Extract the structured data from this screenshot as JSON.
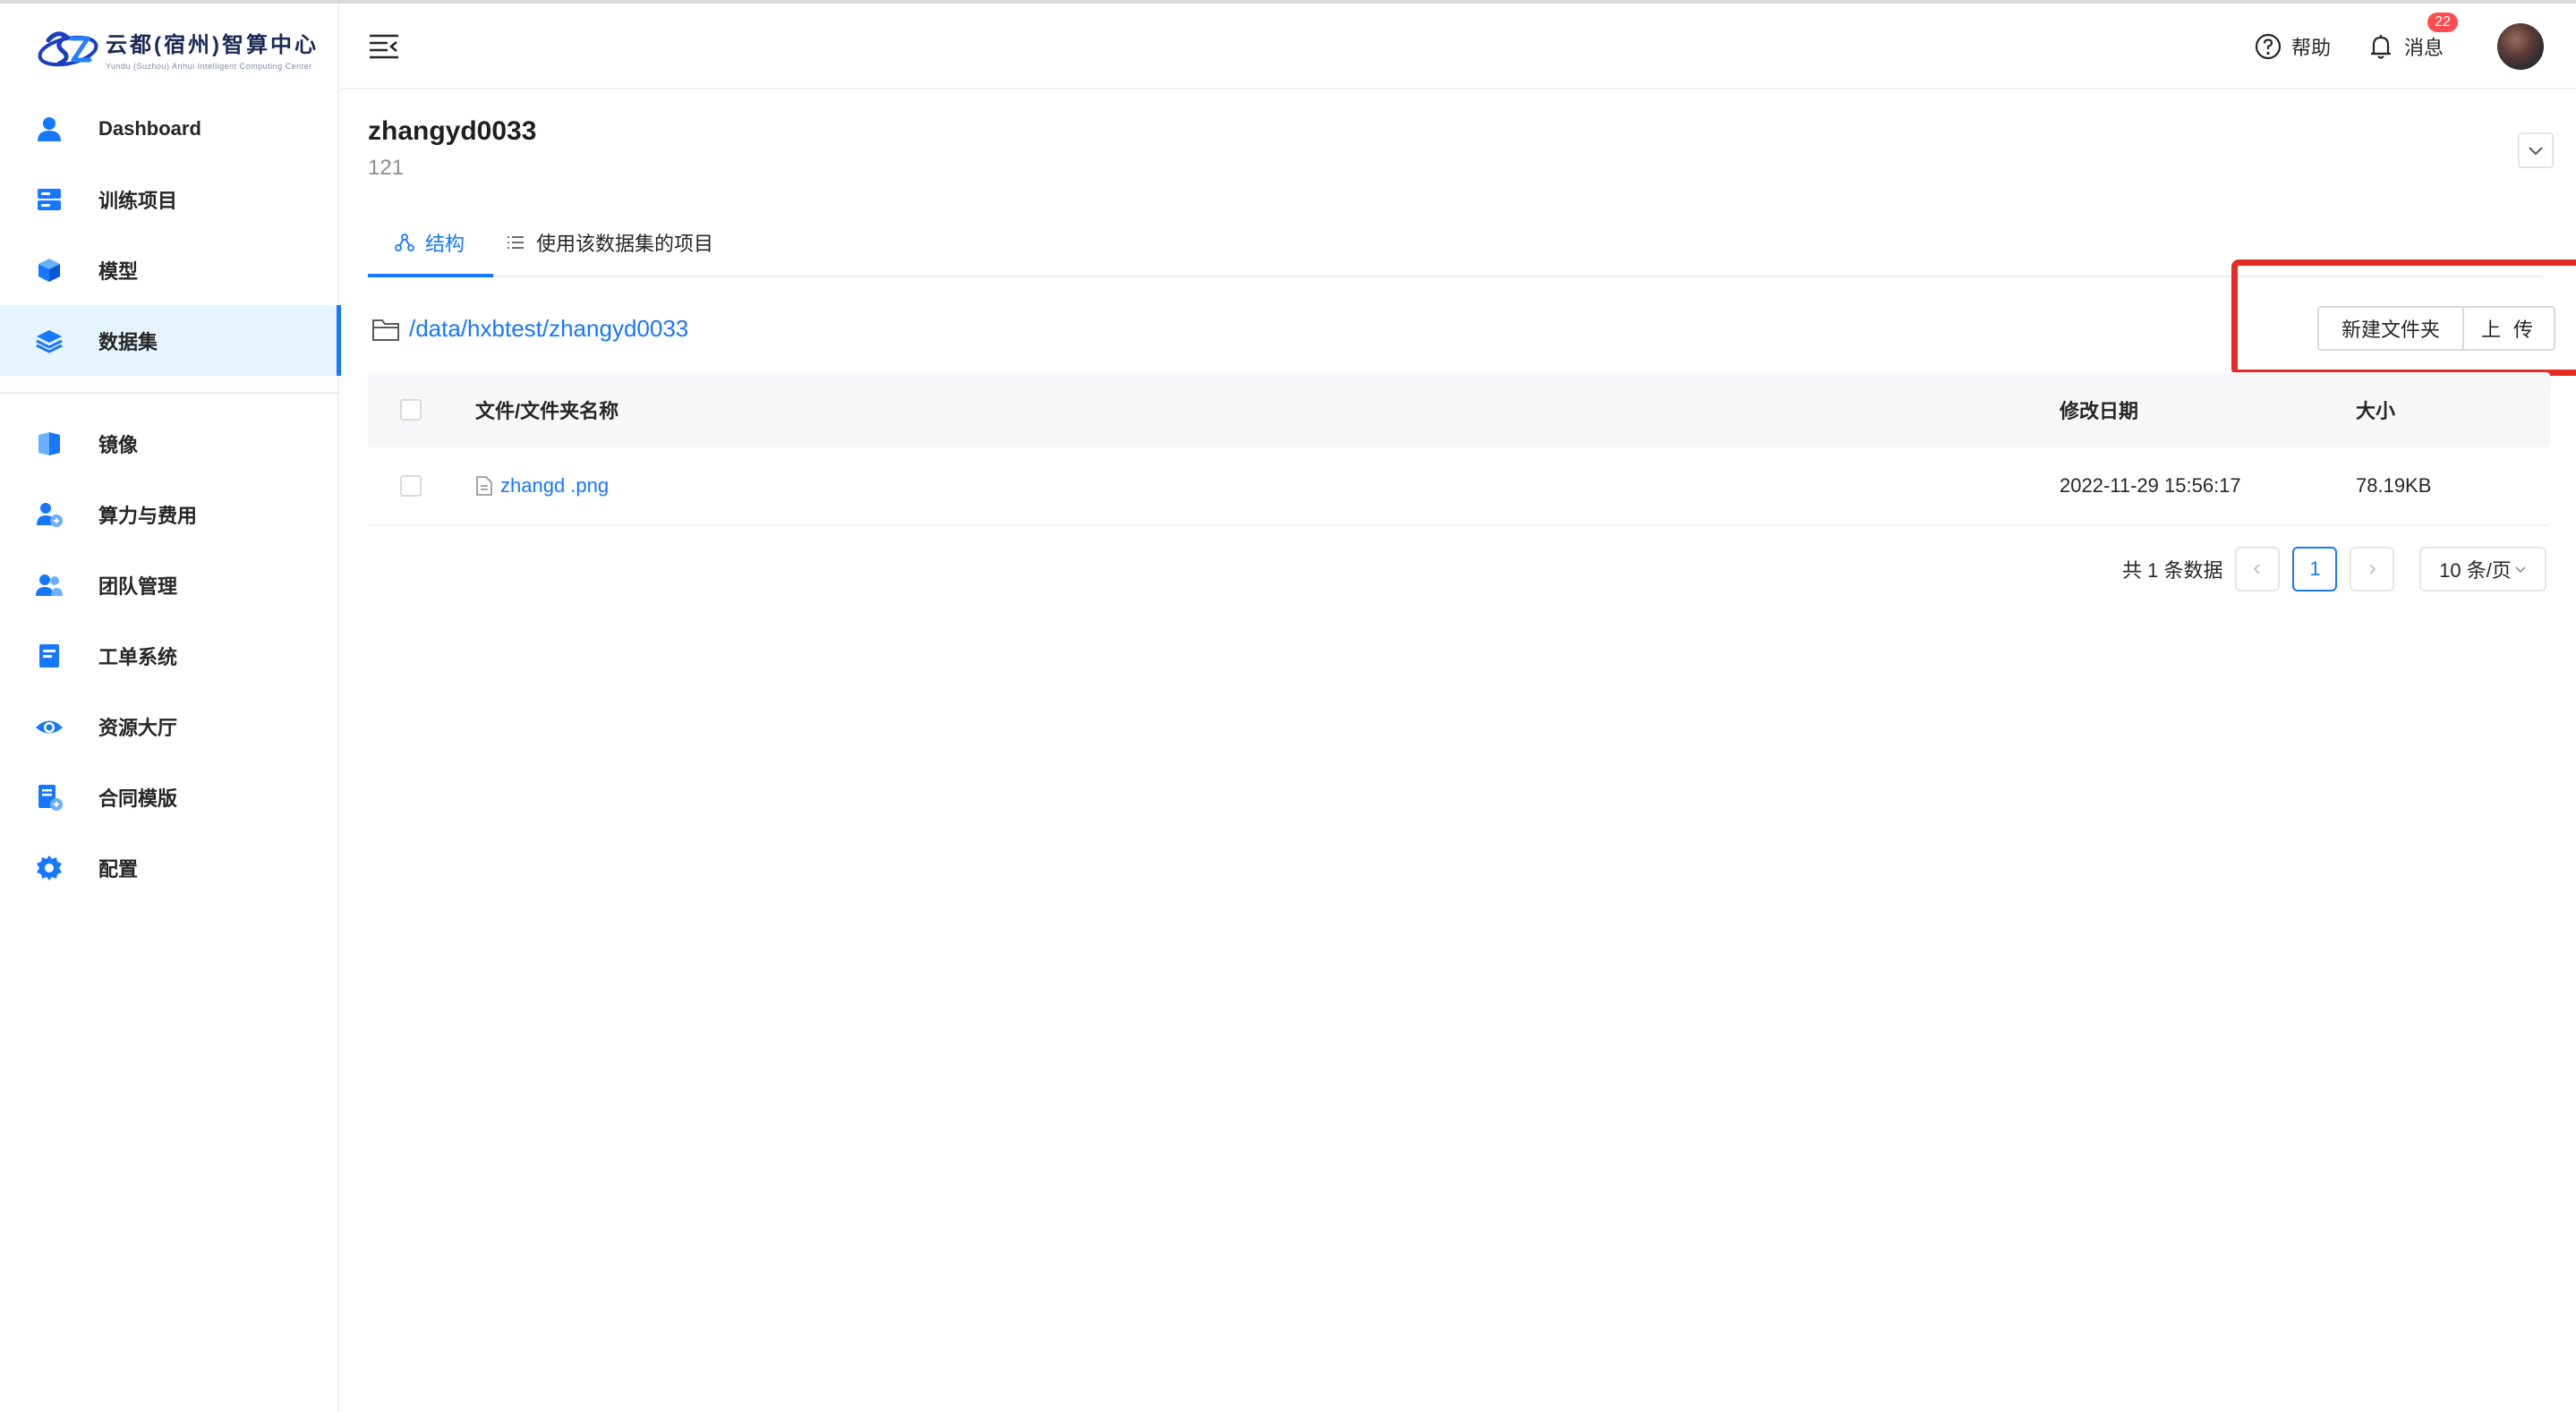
{
  "brand": {
    "title": "云都(宿州)智算中心",
    "subtitle": "Yundu (Suzhou) Anhui Intelligent Computing Center",
    "color": "#1a3fbf"
  },
  "sidebar": {
    "items": [
      {
        "label": "Dashboard",
        "icon": "user-icon"
      },
      {
        "label": "训练项目",
        "icon": "server-icon"
      },
      {
        "label": "模型",
        "icon": "cube-icon"
      },
      {
        "label": "数据集",
        "icon": "layers-icon",
        "active": true
      },
      {
        "label": "镜像",
        "icon": "image-icon"
      },
      {
        "label": "算力与费用",
        "icon": "compute-cost-icon"
      },
      {
        "label": "团队管理",
        "icon": "team-icon"
      },
      {
        "label": "工单系统",
        "icon": "ticket-icon"
      },
      {
        "label": "资源大厅",
        "icon": "eye-icon"
      },
      {
        "label": "合同模版",
        "icon": "contract-icon"
      },
      {
        "label": "配置",
        "icon": "gear-icon"
      }
    ]
  },
  "header": {
    "help_label": "帮助",
    "message_label": "消息",
    "message_count": "22"
  },
  "dataset": {
    "name": "zhangyd0033",
    "description": "121"
  },
  "tabs": [
    {
      "label": "结构",
      "active": true
    },
    {
      "label": "使用该数据集的项目",
      "active": false
    }
  ],
  "path": "/data/hxbtest/zhangyd0033",
  "actions": {
    "new_folder": "新建文件夹",
    "upload": "上 传"
  },
  "table": {
    "columns": [
      "文件/文件夹名称",
      "修改日期",
      "大小"
    ],
    "rows": [
      {
        "name": "zhangd .png",
        "modified": "2022-11-29 15:56:17",
        "size": "78.19KB"
      }
    ]
  },
  "pagination": {
    "total": "共 1 条数据",
    "current_page": "1",
    "page_size": "10 条/页"
  },
  "colors": {
    "accent": "#1677ff",
    "highlight": "#e32d25",
    "badge": "#ff4d4f"
  }
}
